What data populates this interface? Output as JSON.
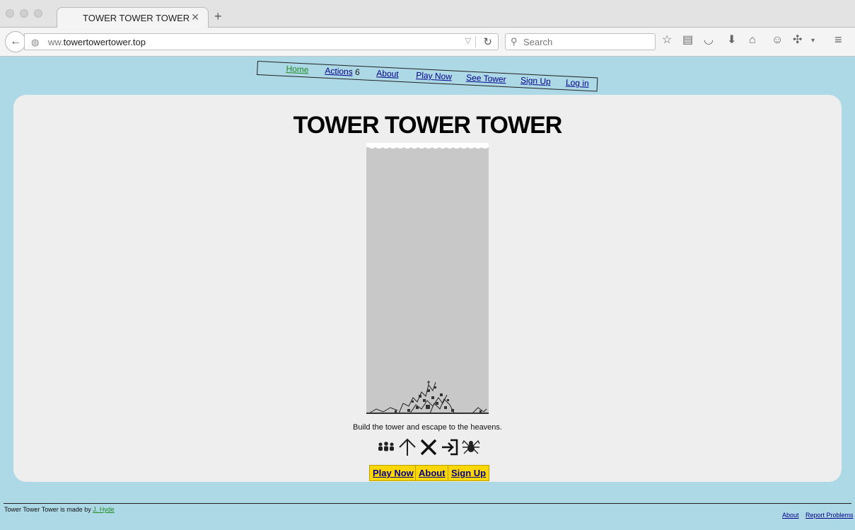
{
  "browser": {
    "tab_title": "TOWER TOWER TOWER",
    "url_prefix": "ww.",
    "url_domain": "towertowertower.top",
    "search_placeholder": "Search"
  },
  "nav": {
    "home": "Home",
    "actions": "Actions",
    "actions_count": ": 6",
    "about": "About",
    "play_now": "Play Now",
    "see_tower": "See Tower",
    "sign_up": "Sign Up",
    "log_in": "Log in"
  },
  "main": {
    "title": "TOWER TOWER TOWER",
    "tagline": "Build the tower and escape to the heavens.",
    "icons": [
      "people-icon",
      "up-arrow-icon",
      "cross-icon",
      "enter-icon",
      "spider-icon"
    ],
    "buttons": {
      "play_now": "Play Now",
      "about": "About",
      "sign_up": "Sign Up"
    }
  },
  "footer": {
    "credit_text": "Tower Tower Tower is made by ",
    "credit_link": "J. Hyde",
    "about": "About",
    "report": "Report Problems"
  },
  "colors": {
    "background": "#add8e6",
    "panel": "#eeeeee",
    "button": "#ffd700",
    "link": "#00008b",
    "active_link": "#228b22"
  }
}
